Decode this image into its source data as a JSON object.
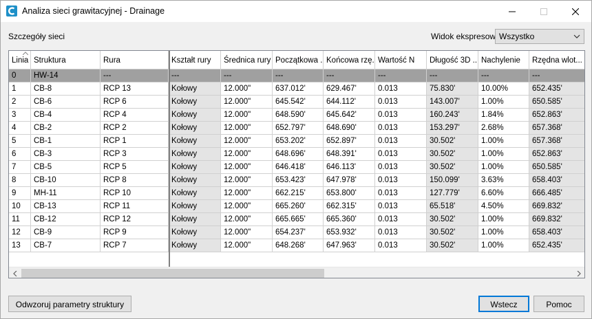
{
  "window": {
    "title": "Analiza sieci grawitacyjnej - Drainage"
  },
  "header": {
    "section_label": "Szczegóły sieci",
    "view_label": "Widok ekspresowy",
    "view_value": "Wszystko"
  },
  "columns": [
    "Linia",
    "Struktura",
    "Rura",
    "Kształt rury",
    "Średnica rury",
    "Początkowa ...",
    "Końcowa rzę...",
    "Wartość N",
    "Długość 3D ...",
    "Nachylenie",
    "Rzędna wlot..."
  ],
  "rows": [
    [
      "0",
      "HW-14",
      "---",
      "---",
      "---",
      "---",
      "---",
      "---",
      "---",
      "---",
      "---"
    ],
    [
      "1",
      "CB-8",
      "RCP 13",
      "Kołowy",
      "12.000\"",
      "637.012'",
      "629.467'",
      "0.013",
      "75.830'",
      "10.00%",
      "652.435'"
    ],
    [
      "2",
      "CB-6",
      "RCP 6",
      "Kołowy",
      "12.000\"",
      "645.542'",
      "644.112'",
      "0.013",
      "143.007'",
      "1.00%",
      "650.585'"
    ],
    [
      "3",
      "CB-4",
      "RCP 4",
      "Kołowy",
      "12.000\"",
      "648.590'",
      "645.642'",
      "0.013",
      "160.243'",
      "1.84%",
      "652.863'"
    ],
    [
      "4",
      "CB-2",
      "RCP 2",
      "Kołowy",
      "12.000\"",
      "652.797'",
      "648.690'",
      "0.013",
      "153.297'",
      "2.68%",
      "657.368'"
    ],
    [
      "5",
      "CB-1",
      "RCP 1",
      "Kołowy",
      "12.000\"",
      "653.202'",
      "652.897'",
      "0.013",
      "30.502'",
      "1.00%",
      "657.368'"
    ],
    [
      "6",
      "CB-3",
      "RCP 3",
      "Kołowy",
      "12.000\"",
      "648.696'",
      "648.391'",
      "0.013",
      "30.502'",
      "1.00%",
      "652.863'"
    ],
    [
      "7",
      "CB-5",
      "RCP 5",
      "Kołowy",
      "12.000\"",
      "646.418'",
      "646.113'",
      "0.013",
      "30.502'",
      "1.00%",
      "650.585'"
    ],
    [
      "8",
      "CB-10",
      "RCP 8",
      "Kołowy",
      "12.000\"",
      "653.423'",
      "647.978'",
      "0.013",
      "150.099'",
      "3.63%",
      "658.403'"
    ],
    [
      "9",
      "MH-11",
      "RCP 10",
      "Kołowy",
      "12.000\"",
      "662.215'",
      "653.800'",
      "0.013",
      "127.779'",
      "6.60%",
      "666.485'"
    ],
    [
      "10",
      "CB-13",
      "RCP 11",
      "Kołowy",
      "12.000\"",
      "665.260'",
      "662.315'",
      "0.013",
      "65.518'",
      "4.50%",
      "669.832'"
    ],
    [
      "11",
      "CB-12",
      "RCP 12",
      "Kołowy",
      "12.000\"",
      "665.665'",
      "665.360'",
      "0.013",
      "30.502'",
      "1.00%",
      "669.832'"
    ],
    [
      "12",
      "CB-9",
      "RCP 9",
      "Kołowy",
      "12.000\"",
      "654.237'",
      "653.932'",
      "0.013",
      "30.502'",
      "1.00%",
      "658.403'"
    ],
    [
      "13",
      "CB-7",
      "RCP 7",
      "Kołowy",
      "12.000\"",
      "648.268'",
      "647.963'",
      "0.013",
      "30.502'",
      "1.00%",
      "652.435'"
    ]
  ],
  "selected_row_index": 0,
  "gray_column_indices": [
    3,
    8,
    10
  ],
  "buttons": {
    "map_params": "Odwzoruj parametry struktury",
    "back": "Wstecz",
    "help": "Pomoc"
  },
  "colors": {
    "selected_row": "#a0a0a0",
    "readonly_cell": "#e4e4e4",
    "primary_border": "#0078d7",
    "app_icon": "#1e90c8"
  }
}
